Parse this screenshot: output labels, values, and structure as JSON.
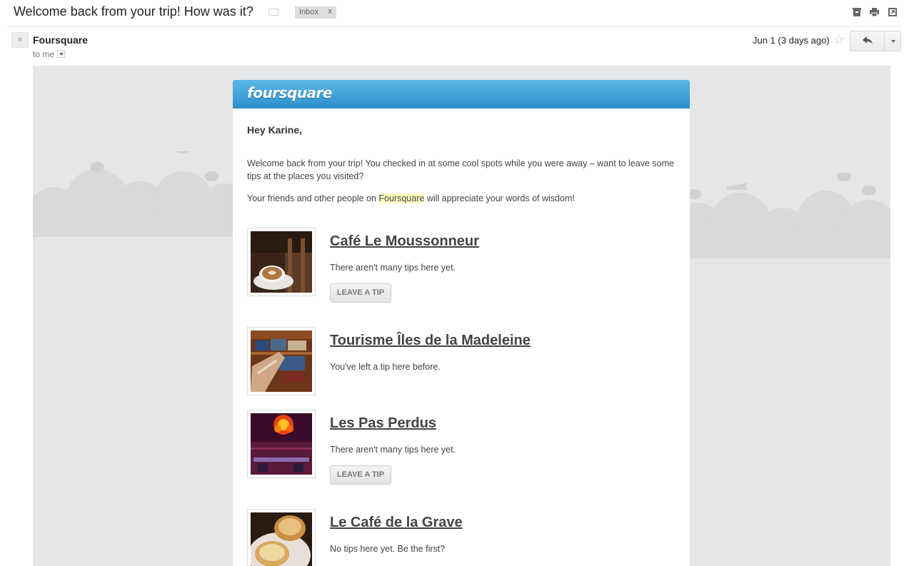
{
  "subject": {
    "title": "Welcome back from your trip! How was it?",
    "label": "Inbox",
    "label_close": "x"
  },
  "top_icons": [
    "archive-icon",
    "print-icon",
    "new-window-icon"
  ],
  "message": {
    "sender": "Foursquare",
    "to": "to me",
    "date": "Jun 1 (3 days ago)"
  },
  "email": {
    "brand": "foursquare",
    "brand_color": "#2b8fcc",
    "greeting": "Hey Karine,",
    "para1": "Welcome back from your trip! You checked in at some cool spots while you were away – want to leave some tips at the places you visited?",
    "para2_before": "Your friends and other people on ",
    "para2_highlight": "Foursquare",
    "para2_after": " will appreciate your words of wisdom!",
    "venues": [
      {
        "name": "Café Le Moussonneur",
        "status": "There aren't many tips here yet.",
        "button": "LEAVE A TIP"
      },
      {
        "name": "Tourisme Îles de la Madeleine",
        "status": "You've left a tip here before."
      },
      {
        "name": "Les Pas Perdus",
        "status": "There aren't many tips here yet.",
        "button": "LEAVE A TIP"
      },
      {
        "name": "Le Café de la Grave",
        "status": "No tips here yet. Be the first?"
      }
    ]
  }
}
